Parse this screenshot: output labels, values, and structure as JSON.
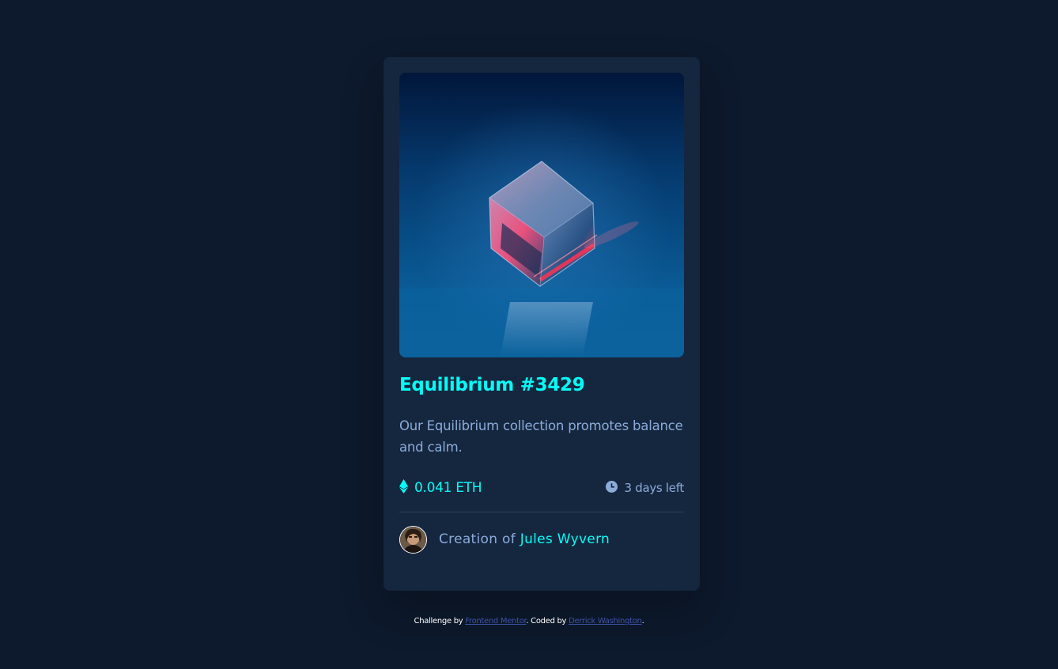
{
  "card": {
    "title": "Equilibrium #3429",
    "description": "Our Equilibrium collection promotes balance and calm.",
    "price": "0.041 ETH",
    "time_left": "3 days left",
    "creator_prefix": "Creation of",
    "creator_name": "Jules Wyvern",
    "icons": {
      "price": "ethereum-icon",
      "time": "clock-icon"
    }
  },
  "attribution": {
    "prefix": "Challenge by",
    "link1": "Frontend Mentor",
    "middle": ". Coded by",
    "link2": "Derrick Washington",
    "suffix": "."
  },
  "colors": {
    "background": "#0d192c",
    "card": "#15263f",
    "accent": "#00fff8",
    "muted_text": "#8bacd9",
    "divider": "#2e405a",
    "link": "#3e52a3"
  }
}
